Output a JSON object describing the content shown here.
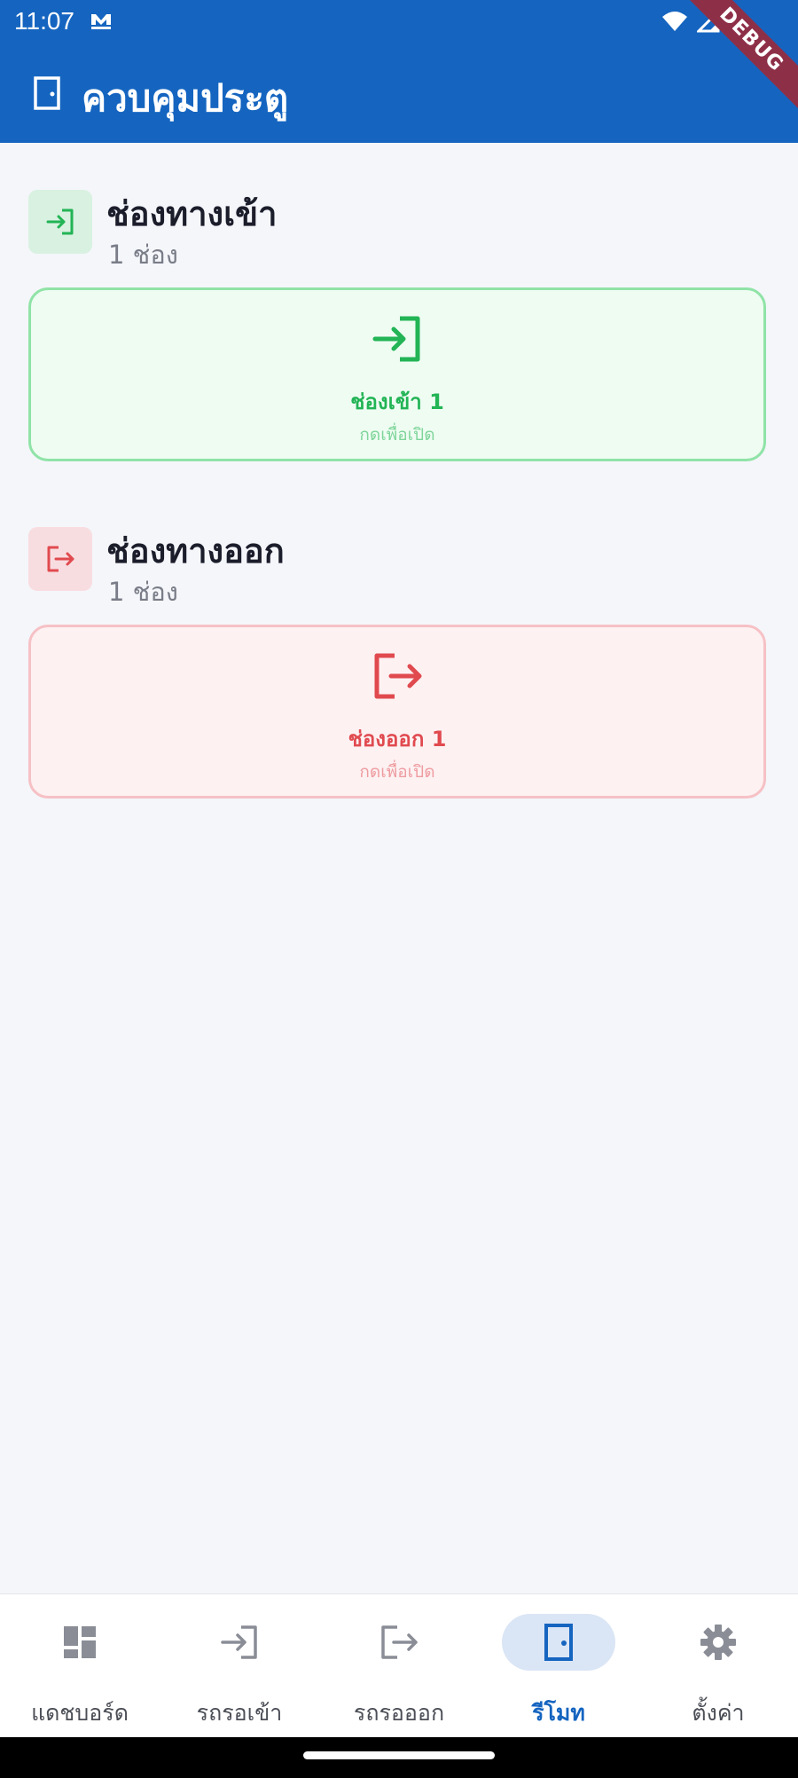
{
  "status_bar": {
    "time": "11:07",
    "icons": [
      "wifi-icon",
      "signal-icon",
      "battery-icon"
    ],
    "debug_label": "DEBUG"
  },
  "app_bar": {
    "title": "ควบคุมประตู",
    "icon": "door-icon"
  },
  "sections": [
    {
      "title": "ช่องทางเข้า",
      "count": "1 ช่อง",
      "icon": "login-icon",
      "gates": [
        {
          "name": "ช่องเข้า 1",
          "hint": "กดเพื่อเปิด",
          "icon": "login-icon"
        }
      ]
    },
    {
      "title": "ช่องทางออก",
      "count": "1 ช่อง",
      "icon": "logout-icon",
      "gates": [
        {
          "name": "ช่องออก 1",
          "hint": "กดเพื่อเปิด",
          "icon": "logout-icon"
        }
      ]
    }
  ],
  "bottom_nav": {
    "items": [
      {
        "label": "แดชบอร์ด",
        "icon": "dashboard-icon",
        "active": false
      },
      {
        "label": "รถรอเข้า",
        "icon": "login-icon",
        "active": false
      },
      {
        "label": "รถรอออก",
        "icon": "logout-icon",
        "active": false
      },
      {
        "label": "รีโมท",
        "icon": "door-icon",
        "active": true
      },
      {
        "label": "ตั้งค่า",
        "icon": "gear-icon",
        "active": false
      }
    ]
  },
  "colors": {
    "primary": "#1565c0",
    "entry_green": "#22b455",
    "exit_red": "#e04a4f",
    "background": "#f4f6fa"
  }
}
